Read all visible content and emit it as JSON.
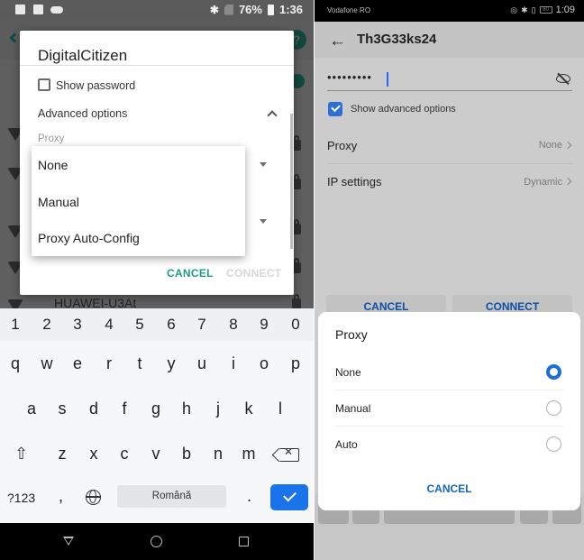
{
  "left_phone": {
    "status_bar": {
      "notification_icons": [
        "document-icon",
        "image-icon",
        "cloud-icon"
      ],
      "system_icons": [
        "bluetooth-icon",
        "no-sim-icon"
      ],
      "battery": "76%",
      "time": "1:36"
    },
    "background_network": "HUAWEI-U3At",
    "dialog": {
      "title": "DigitalCitizen",
      "show_password_label": "Show password",
      "show_password_checked": false,
      "advanced_options_label": "Advanced options",
      "proxy_label": "Proxy",
      "proxy_menu_options": [
        "None",
        "Manual",
        "Proxy Auto-Config"
      ],
      "cancel_label": "CANCEL",
      "connect_label": "CONNECT"
    },
    "keyboard": {
      "number_row": [
        "1",
        "2",
        "3",
        "4",
        "5",
        "6",
        "7",
        "8",
        "9",
        "0"
      ],
      "row1": [
        "q",
        "w",
        "e",
        "r",
        "t",
        "y",
        "u",
        "i",
        "o",
        "p"
      ],
      "row2": [
        "a",
        "s",
        "d",
        "f",
        "g",
        "h",
        "j",
        "k",
        "l"
      ],
      "row3": [
        "z",
        "x",
        "c",
        "v",
        "b",
        "n",
        "m"
      ],
      "symbols_key": "?123",
      "comma_key": ",",
      "space_label": "Română",
      "period_key": ".",
      "shift_glyph": "⇧",
      "backspace_glyph": "✕"
    }
  },
  "right_phone": {
    "status_bar": {
      "carrier": "Vodafone RO",
      "battery": "80",
      "time": "1:09"
    },
    "app_bar": {
      "back_glyph": "←",
      "title": "Th3G33ks24"
    },
    "password_field": {
      "value_masked": "•••••••••"
    },
    "show_advanced_label": "Show advanced options",
    "show_advanced_checked": true,
    "rows": [
      {
        "label": "Proxy",
        "value": "None"
      },
      {
        "label": "IP settings",
        "value": "Dynamic"
      }
    ],
    "buttons": {
      "cancel": "CANCEL",
      "connect": "CONNECT"
    },
    "proxy_dialog": {
      "title": "Proxy",
      "options": [
        {
          "label": "None",
          "selected": true
        },
        {
          "label": "Manual",
          "selected": false
        },
        {
          "label": "Auto",
          "selected": false
        }
      ],
      "cancel_label": "CANCEL"
    }
  },
  "colors": {
    "left_accent": "#1e9d8b",
    "left_keyboard_action": "#1a73e8",
    "right_accent": "#1a6fd8"
  }
}
